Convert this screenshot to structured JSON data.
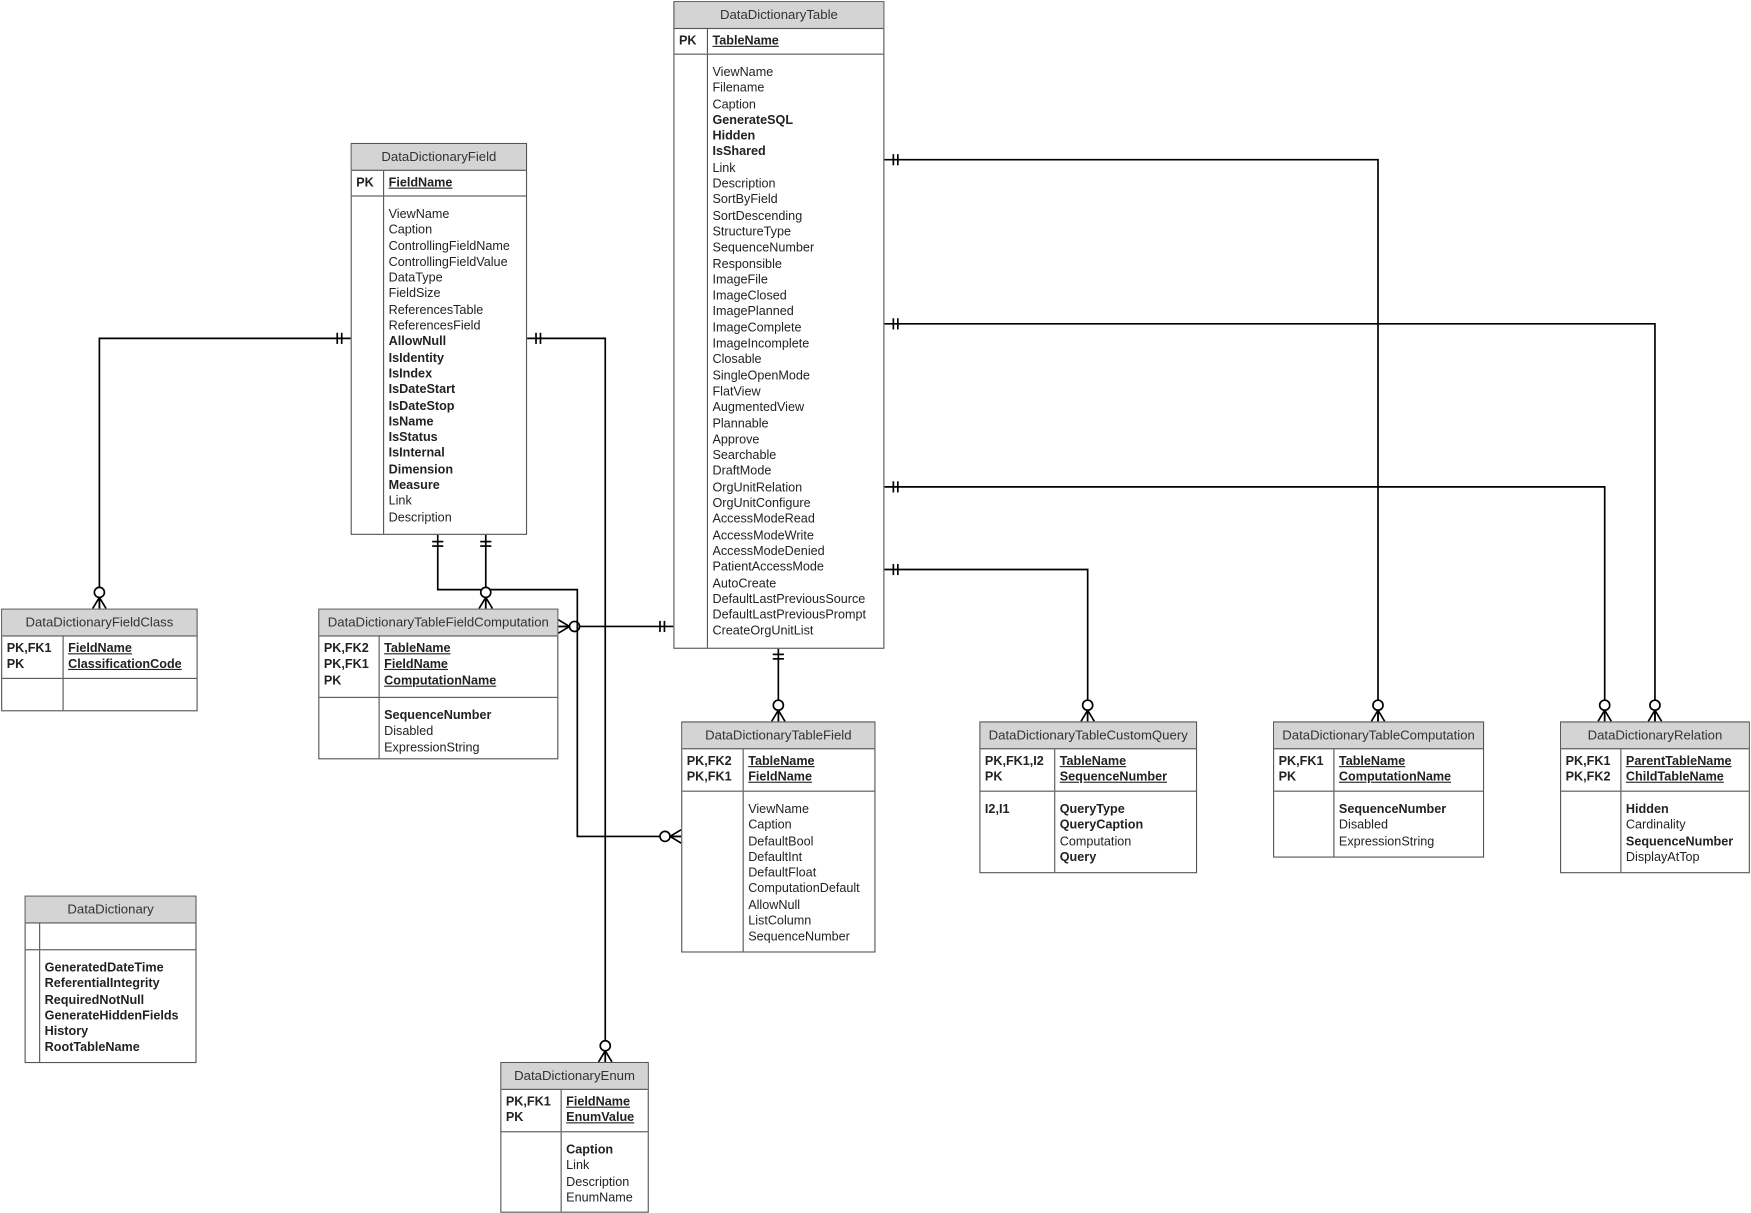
{
  "colors": {
    "header_bg": "#d4d4d4",
    "border": "#555555",
    "line": "#000000"
  },
  "tables": [
    {
      "name": "DataDictionaryTable",
      "keys": [
        {
          "k": "PK",
          "n": "TableName"
        }
      ],
      "body": [
        {
          "n": "ViewName"
        },
        {
          "n": "Filename"
        },
        {
          "n": "Caption"
        },
        {
          "n": "GenerateSQL",
          "b": true
        },
        {
          "n": "Hidden",
          "b": true
        },
        {
          "n": "IsShared",
          "b": true
        },
        {
          "n": "Link"
        },
        {
          "n": "Description"
        },
        {
          "n": "SortByField"
        },
        {
          "n": "SortDescending"
        },
        {
          "n": "StructureType"
        },
        {
          "n": "SequenceNumber"
        },
        {
          "n": "Responsible"
        },
        {
          "n": "ImageFile"
        },
        {
          "n": "ImageClosed"
        },
        {
          "n": "ImagePlanned"
        },
        {
          "n": "ImageComplete"
        },
        {
          "n": "ImageIncomplete"
        },
        {
          "n": "Closable"
        },
        {
          "n": "SingleOpenMode"
        },
        {
          "n": "FlatView"
        },
        {
          "n": "AugmentedView"
        },
        {
          "n": "Plannable"
        },
        {
          "n": "Approve"
        },
        {
          "n": "Searchable"
        },
        {
          "n": "DraftMode"
        },
        {
          "n": "OrgUnitRelation"
        },
        {
          "n": "OrgUnitConfigure"
        },
        {
          "n": "AccessModeRead"
        },
        {
          "n": "AccessModeWrite"
        },
        {
          "n": "AccessModeDenied"
        },
        {
          "n": "PatientAccessMode"
        },
        {
          "n": "AutoCreate"
        },
        {
          "n": "DefaultLastPreviousSource"
        },
        {
          "n": "DefaultLastPreviousPrompt"
        },
        {
          "n": "CreateOrgUnitList"
        }
      ]
    },
    {
      "name": "DataDictionaryField",
      "keys": [
        {
          "k": "PK",
          "n": "FieldName"
        }
      ],
      "body": [
        {
          "n": "ViewName"
        },
        {
          "n": "Caption"
        },
        {
          "n": "ControllingFieldName"
        },
        {
          "n": "ControllingFieldValue"
        },
        {
          "n": "DataType"
        },
        {
          "n": "FieldSize"
        },
        {
          "n": "ReferencesTable"
        },
        {
          "n": "ReferencesField"
        },
        {
          "n": "AllowNull",
          "b": true
        },
        {
          "n": "IsIdentity",
          "b": true
        },
        {
          "n": "IsIndex",
          "b": true
        },
        {
          "n": "IsDateStart",
          "b": true
        },
        {
          "n": "IsDateStop",
          "b": true
        },
        {
          "n": "IsName",
          "b": true
        },
        {
          "n": "IsStatus",
          "b": true
        },
        {
          "n": "IsInternal",
          "b": true
        },
        {
          "n": "Dimension",
          "b": true
        },
        {
          "n": "Measure",
          "b": true
        },
        {
          "n": "Link"
        },
        {
          "n": "Description"
        }
      ]
    },
    {
      "name": "DataDictionaryFieldClass",
      "keys": [
        {
          "k": "PK,FK1",
          "n": "FieldName"
        },
        {
          "k": "PK",
          "n": "ClassificationCode"
        }
      ],
      "body": []
    },
    {
      "name": "DataDictionaryTableFieldComputation",
      "keys": [
        {
          "k": "PK,FK2",
          "n": "TableName"
        },
        {
          "k": "PK,FK1",
          "n": "FieldName"
        },
        {
          "k": "PK",
          "n": "ComputationName"
        }
      ],
      "body": [
        {
          "n": "SequenceNumber",
          "b": true
        },
        {
          "n": "Disabled"
        },
        {
          "n": "ExpressionString"
        }
      ]
    },
    {
      "name": "DataDictionaryTableField",
      "keys": [
        {
          "k": "PK,FK2",
          "n": "TableName"
        },
        {
          "k": "PK,FK1",
          "n": "FieldName"
        }
      ],
      "body": [
        {
          "n": "ViewName"
        },
        {
          "n": "Caption"
        },
        {
          "n": "DefaultBool"
        },
        {
          "n": "DefaultInt"
        },
        {
          "n": "DefaultFloat"
        },
        {
          "n": "ComputationDefault"
        },
        {
          "n": "AllowNull"
        },
        {
          "n": "ListColumn"
        },
        {
          "n": "SequenceNumber"
        }
      ]
    },
    {
      "name": "DataDictionaryTableCustomQuery",
      "keys": [
        {
          "k": "PK,FK1,I2",
          "n": "TableName"
        },
        {
          "k": "PK",
          "n": "SequenceNumber"
        }
      ],
      "body": [
        {
          "k": "I2,I1",
          "n": "QueryType",
          "b": true
        },
        {
          "n": "QueryCaption",
          "b": true
        },
        {
          "n": "Computation"
        },
        {
          "n": "Query",
          "b": true
        }
      ]
    },
    {
      "name": "DataDictionaryTableComputation",
      "keys": [
        {
          "k": "PK,FK1",
          "n": "TableName"
        },
        {
          "k": "PK",
          "n": "ComputationName"
        }
      ],
      "body": [
        {
          "n": "SequenceNumber",
          "b": true
        },
        {
          "n": "Disabled"
        },
        {
          "n": "ExpressionString"
        }
      ]
    },
    {
      "name": "DataDictionaryRelation",
      "keys": [
        {
          "k": "PK,FK1",
          "n": "ParentTableName"
        },
        {
          "k": "PK,FK2",
          "n": "ChildTableName"
        }
      ],
      "body": [
        {
          "n": "Hidden",
          "b": true
        },
        {
          "n": "Cardinality"
        },
        {
          "n": "SequenceNumber",
          "b": true
        },
        {
          "n": "DisplayAtTop"
        }
      ]
    },
    {
      "name": "DataDictionary",
      "keys": [],
      "body": [
        {
          "n": "GeneratedDateTime",
          "b": true
        },
        {
          "n": "ReferentialIntegrity",
          "b": true
        },
        {
          "n": "RequiredNotNull",
          "b": true
        },
        {
          "n": "GenerateHiddenFields",
          "b": true
        },
        {
          "n": "History",
          "b": true
        },
        {
          "n": "RootTableName",
          "b": true
        }
      ]
    },
    {
      "name": "DataDictionaryEnum",
      "keys": [
        {
          "k": "PK,FK1",
          "n": "FieldName"
        },
        {
          "k": "PK",
          "n": "EnumValue"
        }
      ],
      "body": [
        {
          "n": "Caption",
          "b": true
        },
        {
          "n": "Link"
        },
        {
          "n": "Description"
        },
        {
          "n": "EnumName"
        }
      ]
    }
  ],
  "relationships": [
    {
      "from": "DataDictionaryTable",
      "to": "DataDictionaryTableComputation",
      "from_card": "one-and-only-one",
      "to_card": "zero-or-many"
    },
    {
      "from": "DataDictionaryTable",
      "to": "DataDictionaryRelation",
      "from_card": "one-and-only-one",
      "to_card": "zero-or-many"
    },
    {
      "from": "DataDictionaryTable",
      "to": "DataDictionaryRelation",
      "from_card": "one-and-only-one",
      "to_card": "zero-or-many"
    },
    {
      "from": "DataDictionaryTable",
      "to": "DataDictionaryTableCustomQuery",
      "from_card": "one-and-only-one",
      "to_card": "zero-or-many"
    },
    {
      "from": "DataDictionaryTable",
      "to": "DataDictionaryTableField",
      "from_card": "one-and-only-one",
      "to_card": "zero-or-many"
    },
    {
      "from": "DataDictionaryTable",
      "to": "DataDictionaryTableFieldComputation",
      "from_card": "one-and-only-one",
      "to_card": "zero-or-many"
    },
    {
      "from": "DataDictionaryField",
      "to": "DataDictionaryFieldClass",
      "from_card": "one-and-only-one",
      "to_card": "zero-or-many"
    },
    {
      "from": "DataDictionaryField",
      "to": "DataDictionaryEnum",
      "from_card": "one-and-only-one",
      "to_card": "zero-or-many"
    },
    {
      "from": "DataDictionaryField",
      "to": "DataDictionaryTableField",
      "from_card": "one-and-only-one",
      "to_card": "zero-or-many"
    },
    {
      "from": "DataDictionaryField",
      "to": "DataDictionaryTableFieldComputation",
      "from_card": "one-and-only-one",
      "to_card": "zero-or-many"
    }
  ]
}
